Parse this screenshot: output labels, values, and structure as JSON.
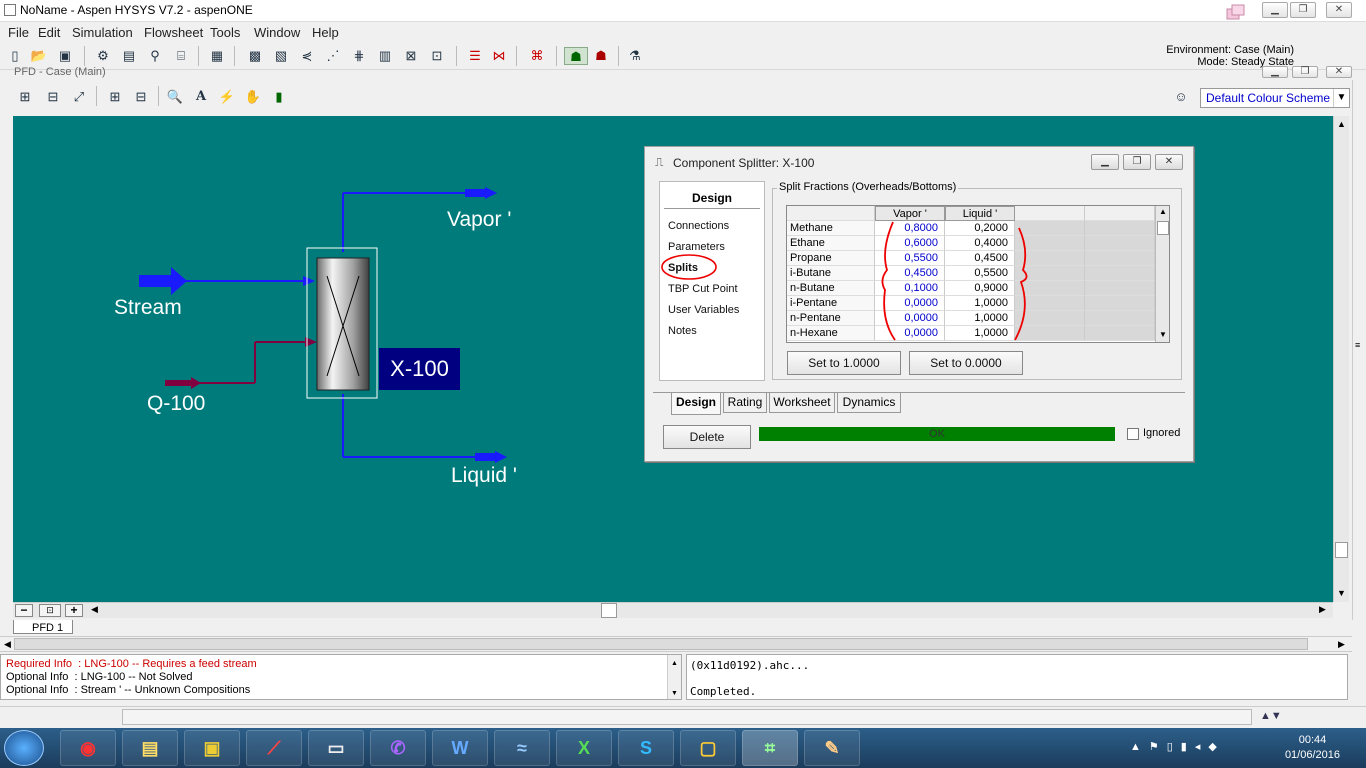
{
  "window": {
    "title": "NoName - Aspen HYSYS V7.2 - aspenONE"
  },
  "menu": [
    "File",
    "Edit",
    "Simulation",
    "Flowsheet",
    "Tools",
    "Window",
    "Help"
  ],
  "environment": {
    "line1": "Environment: Case (Main)",
    "line2": "Mode: Steady State"
  },
  "pfd": {
    "title": "PFD - Case (Main)",
    "color_scheme": "Default Colour Scheme",
    "tab": "PFD 1",
    "canvas_color": "#007b7b",
    "labels": {
      "stream": "Stream",
      "q": "Q-100",
      "vapor": "Vapor '",
      "liquid": "Liquid '",
      "unit": "X-100"
    }
  },
  "dialog": {
    "title": "Component Splitter: X-100",
    "nav_heading": "Design",
    "nav_items": [
      "Connections",
      "Parameters",
      "Splits",
      "TBP Cut Point",
      "User Variables",
      "Notes"
    ],
    "selected_nav": "Splits",
    "group_title": "Split Fractions (Overheads/Bottoms)",
    "columns": [
      "Vapor '",
      "Liquid '"
    ],
    "rows": [
      {
        "name": "Methane",
        "vapor": "0,8000",
        "liquid": "0,2000"
      },
      {
        "name": "Ethane",
        "vapor": "0,6000",
        "liquid": "0,4000"
      },
      {
        "name": "Propane",
        "vapor": "0,5500",
        "liquid": "0,4500"
      },
      {
        "name": "i-Butane",
        "vapor": "0,4500",
        "liquid": "0,5500"
      },
      {
        "name": "n-Butane",
        "vapor": "0,1000",
        "liquid": "0,9000"
      },
      {
        "name": "i-Pentane",
        "vapor": "0,0000",
        "liquid": "1,0000"
      },
      {
        "name": "n-Pentane",
        "vapor": "0,0000",
        "liquid": "1,0000"
      },
      {
        "name": "n-Hexane",
        "vapor": "0,0000",
        "liquid": "1,0000"
      }
    ],
    "set1": "Set to 1.0000",
    "set0": "Set to 0.0000",
    "tabs": [
      "Design",
      "Rating",
      "Worksheet",
      "Dynamics"
    ],
    "delete": "Delete",
    "status": "OK",
    "ignored": "Ignored"
  },
  "messages": [
    {
      "text": "Required Info  : LNG-100 -- Requires a feed stream",
      "color": "#cc0000"
    },
    {
      "text": "Optional Info  : LNG-100 -- Not Solved",
      "color": "#000000"
    },
    {
      "text": "Optional Info  : Stream ' -- Unknown Compositions",
      "color": "#000000"
    }
  ],
  "log": [
    "(0x11d0192).ahc...",
    "Completed."
  ],
  "clock": {
    "time": "00:44",
    "date": "01/06/2016"
  }
}
